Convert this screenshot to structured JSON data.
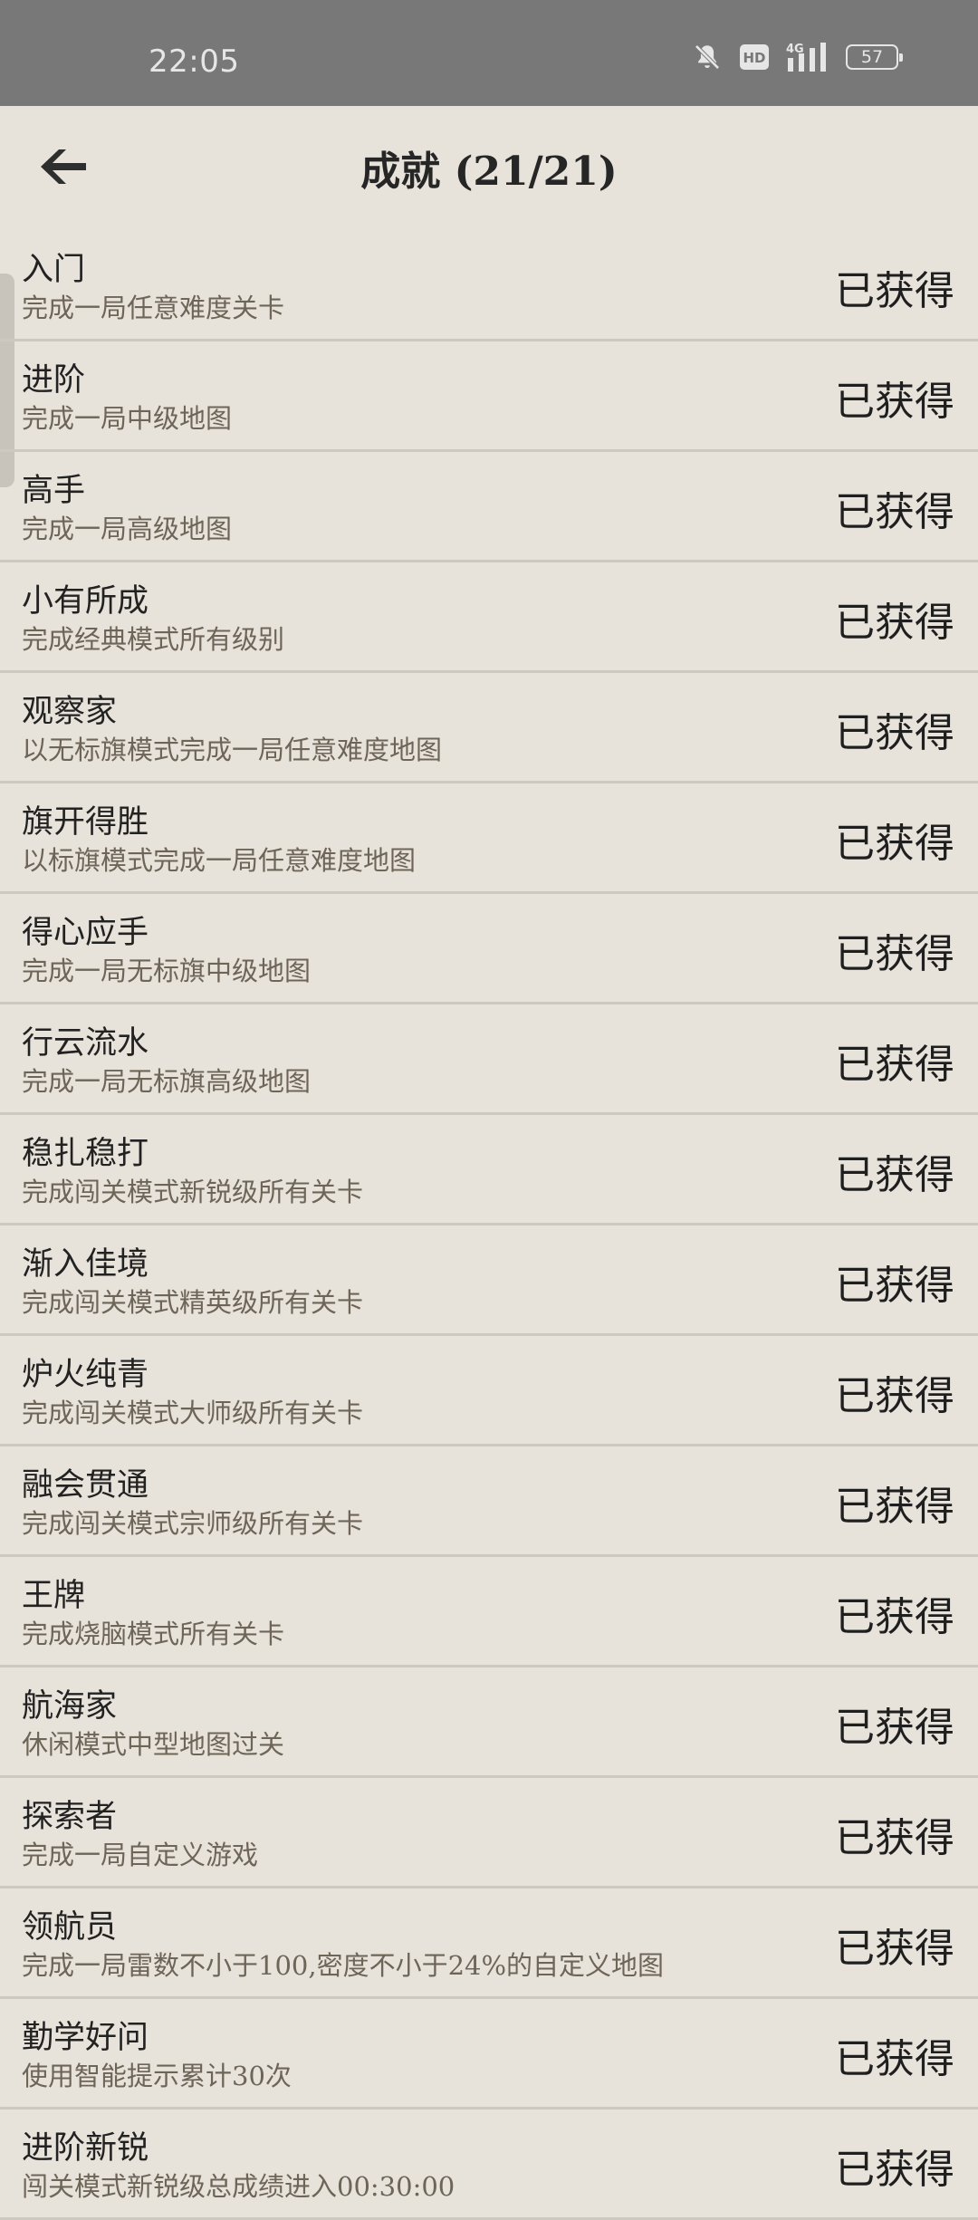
{
  "status_bar": {
    "time": "22:05",
    "icons": [
      "bell-off-icon",
      "hd-icon",
      "signal-4g-icon",
      "battery-icon"
    ],
    "hd_label": "HD",
    "network_label": "4G",
    "battery_level": "57"
  },
  "header": {
    "back_icon": "arrow-left-icon",
    "title": "成就 (21/21)"
  },
  "achievements": [
    {
      "name": "入门",
      "desc": "完成一局任意难度关卡",
      "status": "已获得"
    },
    {
      "name": "进阶",
      "desc": "完成一局中级地图",
      "status": "已获得"
    },
    {
      "name": "高手",
      "desc": "完成一局高级地图",
      "status": "已获得"
    },
    {
      "name": "小有所成",
      "desc": "完成经典模式所有级别",
      "status": "已获得"
    },
    {
      "name": "观察家",
      "desc": "以无标旗模式完成一局任意难度地图",
      "status": "已获得"
    },
    {
      "name": "旗开得胜",
      "desc": "以标旗模式完成一局任意难度地图",
      "status": "已获得"
    },
    {
      "name": "得心应手",
      "desc": "完成一局无标旗中级地图",
      "status": "已获得"
    },
    {
      "name": "行云流水",
      "desc": "完成一局无标旗高级地图",
      "status": "已获得"
    },
    {
      "name": "稳扎稳打",
      "desc": "完成闯关模式新锐级所有关卡",
      "status": "已获得"
    },
    {
      "name": "渐入佳境",
      "desc": "完成闯关模式精英级所有关卡",
      "status": "已获得"
    },
    {
      "name": "炉火纯青",
      "desc": "完成闯关模式大师级所有关卡",
      "status": "已获得"
    },
    {
      "name": "融会贯通",
      "desc": "完成闯关模式宗师级所有关卡",
      "status": "已获得"
    },
    {
      "name": "王牌",
      "desc": "完成烧脑模式所有关卡",
      "status": "已获得"
    },
    {
      "name": "航海家",
      "desc": "休闲模式中型地图过关",
      "status": "已获得"
    },
    {
      "name": "探索者",
      "desc": "完成一局自定义游戏",
      "status": "已获得"
    },
    {
      "name": "领航员",
      "desc": "完成一局雷数不小于100,密度不小于24%的自定义地图",
      "status": "已获得"
    },
    {
      "name": "勤学好问",
      "desc": "使用智能提示累计30次",
      "status": "已获得"
    },
    {
      "name": "进阶新锐",
      "desc": "闯关模式新锐级总成绩进入00:30:00",
      "status": "已获得"
    }
  ]
}
